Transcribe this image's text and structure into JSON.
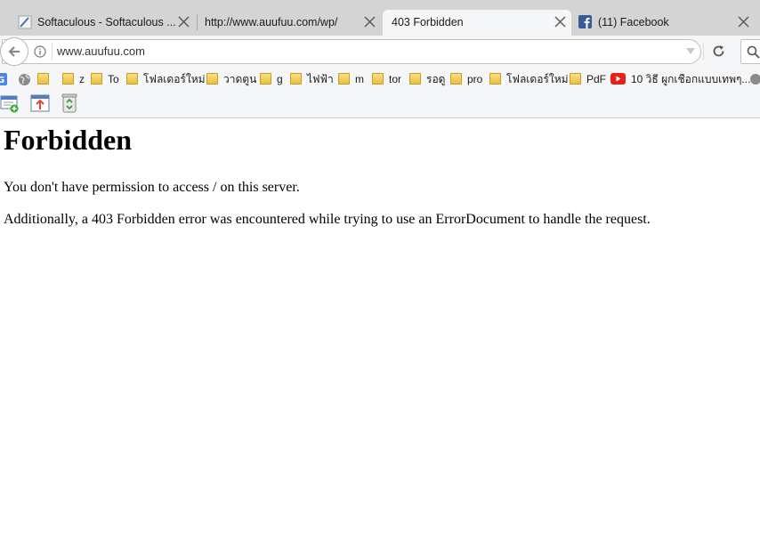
{
  "tabs": [
    {
      "title": "Softaculous - Softaculous ...",
      "active": false
    },
    {
      "title": "http://www.auufuu.com/wp/",
      "active": false
    },
    {
      "title": "403 Forbidden",
      "active": true
    },
    {
      "title": "(11) Facebook",
      "active": false
    }
  ],
  "address_bar": {
    "url": "www.auufuu.com"
  },
  "bookmarks": [
    {
      "label": "",
      "icon": "google-icon"
    },
    {
      "label": "",
      "icon": "globe-icon"
    },
    {
      "label": "",
      "icon": "folder-icon"
    },
    {
      "label": "z",
      "icon": "folder-icon"
    },
    {
      "label": "To",
      "icon": "folder-icon"
    },
    {
      "label": "โฟลเดอร์ใหม่",
      "icon": "folder-icon"
    },
    {
      "label": "วาดตูน",
      "icon": "folder-icon"
    },
    {
      "label": "g",
      "icon": "folder-icon"
    },
    {
      "label": "ไฟฟ้า",
      "icon": "folder-icon"
    },
    {
      "label": "m",
      "icon": "folder-icon"
    },
    {
      "label": "tor",
      "icon": "folder-icon"
    },
    {
      "label": "รอดู",
      "icon": "folder-icon"
    },
    {
      "label": "pro",
      "icon": "folder-icon"
    },
    {
      "label": "โฟลเดอร์ใหม่",
      "icon": "folder-icon"
    },
    {
      "label": "PdF",
      "icon": "folder-icon"
    },
    {
      "label": "10 วิธี ผูกเชือกแบบเทพๆ...",
      "icon": "youtube-icon"
    }
  ],
  "page": {
    "heading": "Forbidden",
    "message": "You don't have permission to access / on this server.",
    "detail": "Additionally, a 403 Forbidden error was encountered while trying to use an ErrorDocument to handle the request."
  },
  "colors": {
    "tabstrip": "#d4d4d4",
    "toolbar": "#f5f6f7",
    "facebook": "#3b5998",
    "youtube": "#e62117"
  }
}
